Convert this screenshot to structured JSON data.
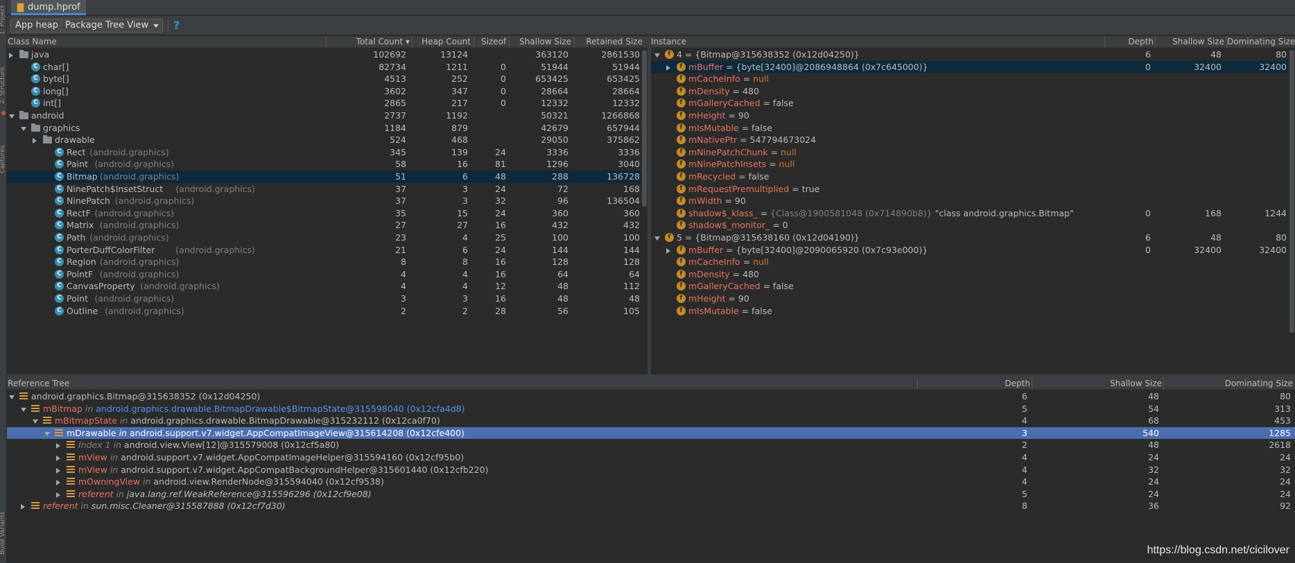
{
  "tab": {
    "title": "dump.hprof"
  },
  "toolbar": {
    "heap": "App heap",
    "view": "Package Tree View",
    "help": "?"
  },
  "sidestrip": [
    "1: Project",
    "2: Structure",
    "Captures",
    "Build Variants"
  ],
  "classTable": {
    "headers": [
      "Class Name",
      "Total Count ▾",
      "Heap Count",
      "Sizeof",
      "Shallow Size",
      "Retained Size"
    ],
    "rows": [
      {
        "indent": 0,
        "exp": "r",
        "icon": "folder",
        "name": "java",
        "pkg": "",
        "total": "102692",
        "heap": "13124",
        "sizeof": "",
        "shallow": "363120",
        "retained": "2861530"
      },
      {
        "indent": 1,
        "exp": "",
        "icon": "class",
        "name": "char[]",
        "pkg": "",
        "total": "82734",
        "heap": "1211",
        "sizeof": "0",
        "shallow": "51944",
        "retained": "51944"
      },
      {
        "indent": 1,
        "exp": "",
        "icon": "class",
        "name": "byte[]",
        "pkg": "",
        "total": "4513",
        "heap": "252",
        "sizeof": "0",
        "shallow": "653425",
        "retained": "653425"
      },
      {
        "indent": 1,
        "exp": "",
        "icon": "class",
        "name": "long[]",
        "pkg": "",
        "total": "3602",
        "heap": "347",
        "sizeof": "0",
        "shallow": "28664",
        "retained": "28664"
      },
      {
        "indent": 1,
        "exp": "",
        "icon": "class",
        "name": "int[]",
        "pkg": "",
        "total": "2865",
        "heap": "217",
        "sizeof": "0",
        "shallow": "12332",
        "retained": "12332"
      },
      {
        "indent": 0,
        "exp": "d",
        "icon": "folder",
        "name": "android",
        "pkg": "",
        "total": "2737",
        "heap": "1192",
        "sizeof": "",
        "shallow": "50321",
        "retained": "1266868"
      },
      {
        "indent": 1,
        "exp": "d",
        "icon": "folder",
        "name": "graphics",
        "pkg": "",
        "total": "1184",
        "heap": "879",
        "sizeof": "",
        "shallow": "42679",
        "retained": "657944"
      },
      {
        "indent": 2,
        "exp": "r",
        "icon": "folder",
        "name": "drawable",
        "pkg": "",
        "total": "524",
        "heap": "468",
        "sizeof": "",
        "shallow": "29050",
        "retained": "375862"
      },
      {
        "indent": 3,
        "exp": "",
        "icon": "class",
        "name": "Rect",
        "pkg": "(android.graphics)",
        "total": "345",
        "heap": "139",
        "sizeof": "24",
        "shallow": "3336",
        "retained": "3336"
      },
      {
        "indent": 3,
        "exp": "",
        "icon": "class",
        "name": "Paint",
        "pkg": "(android.graphics)",
        "total": "58",
        "heap": "16",
        "sizeof": "81",
        "shallow": "1296",
        "retained": "3040"
      },
      {
        "indent": 3,
        "exp": "",
        "icon": "class",
        "name": "Bitmap",
        "pkg": "(android.graphics)",
        "total": "51",
        "heap": "6",
        "sizeof": "48",
        "shallow": "288",
        "retained": "136728",
        "selected": true
      },
      {
        "indent": 3,
        "exp": "",
        "icon": "class",
        "name": "NinePatch$InsetStruct",
        "pkg": "(android.graphics)",
        "total": "37",
        "heap": "3",
        "sizeof": "24",
        "shallow": "72",
        "retained": "168"
      },
      {
        "indent": 3,
        "exp": "",
        "icon": "class",
        "name": "NinePatch",
        "pkg": "(android.graphics)",
        "total": "37",
        "heap": "3",
        "sizeof": "32",
        "shallow": "96",
        "retained": "136504"
      },
      {
        "indent": 3,
        "exp": "",
        "icon": "class",
        "name": "RectF",
        "pkg": "(android.graphics)",
        "total": "35",
        "heap": "15",
        "sizeof": "24",
        "shallow": "360",
        "retained": "360"
      },
      {
        "indent": 3,
        "exp": "",
        "icon": "class",
        "name": "Matrix",
        "pkg": "(android.graphics)",
        "total": "27",
        "heap": "27",
        "sizeof": "16",
        "shallow": "432",
        "retained": "432"
      },
      {
        "indent": 3,
        "exp": "",
        "icon": "class",
        "name": "Path",
        "pkg": "(android.graphics)",
        "total": "23",
        "heap": "4",
        "sizeof": "25",
        "shallow": "100",
        "retained": "100"
      },
      {
        "indent": 3,
        "exp": "",
        "icon": "class",
        "name": "PorterDuffColorFilter",
        "pkg": "(android.graphics)",
        "total": "21",
        "heap": "6",
        "sizeof": "24",
        "shallow": "144",
        "retained": "144"
      },
      {
        "indent": 3,
        "exp": "",
        "icon": "class",
        "name": "Region",
        "pkg": "(android.graphics)",
        "total": "8",
        "heap": "8",
        "sizeof": "16",
        "shallow": "128",
        "retained": "128"
      },
      {
        "indent": 3,
        "exp": "",
        "icon": "class",
        "name": "PointF",
        "pkg": "(android.graphics)",
        "total": "4",
        "heap": "4",
        "sizeof": "16",
        "shallow": "64",
        "retained": "64"
      },
      {
        "indent": 3,
        "exp": "",
        "icon": "class",
        "name": "CanvasProperty",
        "pkg": "(android.graphics)",
        "total": "4",
        "heap": "4",
        "sizeof": "12",
        "shallow": "48",
        "retained": "112"
      },
      {
        "indent": 3,
        "exp": "",
        "icon": "class",
        "name": "Point",
        "pkg": "(android.graphics)",
        "total": "3",
        "heap": "3",
        "sizeof": "16",
        "shallow": "48",
        "retained": "48"
      },
      {
        "indent": 3,
        "exp": "",
        "icon": "class",
        "name": "Outline",
        "pkg": "(android.graphics)",
        "total": "2",
        "heap": "2",
        "sizeof": "28",
        "shallow": "56",
        "retained": "105"
      }
    ]
  },
  "instanceTable": {
    "headers": [
      "Instance",
      "Depth",
      "Shallow Size",
      "Dominating Size"
    ],
    "rows": [
      {
        "indent": 0,
        "exp": "d",
        "parts": [
          [
            "4 = {Bitmap@315638352 (0x12d04250)}",
            ""
          ]
        ],
        "depth": "6",
        "shallow": "48",
        "dom": "80"
      },
      {
        "indent": 1,
        "exp": "r",
        "parts": [
          [
            "mBuffer",
            "fname"
          ],
          [
            " = {byte[32400]@2086948864 (0x7c645000)}",
            ""
          ]
        ],
        "depth": "0",
        "shallow": "32400",
        "dom": "32400",
        "selected": true
      },
      {
        "indent": 1,
        "exp": "",
        "parts": [
          [
            "mCacheInfo",
            "fname"
          ],
          [
            " = ",
            ""
          ],
          [
            "null",
            "orange"
          ]
        ],
        "depth": "",
        "shallow": "",
        "dom": ""
      },
      {
        "indent": 1,
        "exp": "",
        "parts": [
          [
            "mDensity",
            "fname"
          ],
          [
            " = 480",
            ""
          ]
        ],
        "depth": "",
        "shallow": "",
        "dom": ""
      },
      {
        "indent": 1,
        "exp": "",
        "parts": [
          [
            "mGalleryCached",
            "fname"
          ],
          [
            " = false",
            ""
          ]
        ],
        "depth": "",
        "shallow": "",
        "dom": ""
      },
      {
        "indent": 1,
        "exp": "",
        "parts": [
          [
            "mHeight",
            "fname"
          ],
          [
            " = 90",
            ""
          ]
        ],
        "depth": "",
        "shallow": "",
        "dom": ""
      },
      {
        "indent": 1,
        "exp": "",
        "parts": [
          [
            "mIsMutable",
            "fname"
          ],
          [
            " = false",
            ""
          ]
        ],
        "depth": "",
        "shallow": "",
        "dom": ""
      },
      {
        "indent": 1,
        "exp": "",
        "parts": [
          [
            "mNativePtr",
            "fname"
          ],
          [
            " = 547794673024",
            ""
          ]
        ],
        "depth": "",
        "shallow": "",
        "dom": ""
      },
      {
        "indent": 1,
        "exp": "",
        "parts": [
          [
            "mNinePatchChunk",
            "fname"
          ],
          [
            " = ",
            ""
          ],
          [
            "null",
            "orange"
          ]
        ],
        "depth": "",
        "shallow": "",
        "dom": ""
      },
      {
        "indent": 1,
        "exp": "",
        "parts": [
          [
            "mNinePatchInsets",
            "fname"
          ],
          [
            " = ",
            ""
          ],
          [
            "null",
            "orange"
          ]
        ],
        "depth": "",
        "shallow": "",
        "dom": ""
      },
      {
        "indent": 1,
        "exp": "",
        "parts": [
          [
            "mRecycled",
            "fname"
          ],
          [
            " = false",
            ""
          ]
        ],
        "depth": "",
        "shallow": "",
        "dom": ""
      },
      {
        "indent": 1,
        "exp": "",
        "parts": [
          [
            "mRequestPremultiplied",
            "fname"
          ],
          [
            " = true",
            ""
          ]
        ],
        "depth": "",
        "shallow": "",
        "dom": ""
      },
      {
        "indent": 1,
        "exp": "",
        "parts": [
          [
            "mWidth",
            "fname"
          ],
          [
            " = 90",
            ""
          ]
        ],
        "depth": "",
        "shallow": "",
        "dom": ""
      },
      {
        "indent": 1,
        "exp": "",
        "parts": [
          [
            "shadow$_klass_",
            "fname"
          ],
          [
            " = ",
            ""
          ],
          [
            "{Class@1900581048 (0x714890b8)}",
            "gray"
          ],
          [
            " \"class android.graphics.Bitmap\"",
            ""
          ]
        ],
        "depth": "0",
        "shallow": "168",
        "dom": "1244"
      },
      {
        "indent": 1,
        "exp": "",
        "parts": [
          [
            "shadow$_monitor_",
            "fname"
          ],
          [
            " = 0",
            ""
          ]
        ],
        "depth": "",
        "shallow": "",
        "dom": ""
      },
      {
        "indent": 0,
        "exp": "d",
        "parts": [
          [
            "5 = {Bitmap@315638160 (0x12d04190)}",
            ""
          ]
        ],
        "depth": "6",
        "shallow": "48",
        "dom": "80"
      },
      {
        "indent": 1,
        "exp": "r",
        "parts": [
          [
            "mBuffer",
            "fname"
          ],
          [
            " = {byte[32400]@2090065920 (0x7c93e000)}",
            ""
          ]
        ],
        "depth": "0",
        "shallow": "32400",
        "dom": "32400"
      },
      {
        "indent": 1,
        "exp": "",
        "parts": [
          [
            "mCacheInfo",
            "fname"
          ],
          [
            " = ",
            ""
          ],
          [
            "null",
            "orange"
          ]
        ],
        "depth": "",
        "shallow": "",
        "dom": ""
      },
      {
        "indent": 1,
        "exp": "",
        "parts": [
          [
            "mDensity",
            "fname"
          ],
          [
            " = 480",
            ""
          ]
        ],
        "depth": "",
        "shallow": "",
        "dom": ""
      },
      {
        "indent": 1,
        "exp": "",
        "parts": [
          [
            "mGalleryCached",
            "fname"
          ],
          [
            " = false",
            ""
          ]
        ],
        "depth": "",
        "shallow": "",
        "dom": ""
      },
      {
        "indent": 1,
        "exp": "",
        "parts": [
          [
            "mHeight",
            "fname"
          ],
          [
            " = 90",
            ""
          ]
        ],
        "depth": "",
        "shallow": "",
        "dom": ""
      },
      {
        "indent": 1,
        "exp": "",
        "parts": [
          [
            "mIsMutable",
            "fname"
          ],
          [
            " = false",
            ""
          ]
        ],
        "depth": "",
        "shallow": "",
        "dom": ""
      }
    ]
  },
  "refTree": {
    "headers": [
      "Reference Tree",
      "Depth",
      "Shallow Size",
      "Dominating Size"
    ],
    "rows": [
      {
        "indent": 0,
        "exp": "d",
        "parts": [
          [
            "android.graphics.Bitmap@315638352 (0x12d04250)",
            ""
          ]
        ],
        "depth": "6",
        "shallow": "48",
        "dom": "80"
      },
      {
        "indent": 1,
        "exp": "d",
        "parts": [
          [
            "mBitmap",
            "fname"
          ],
          [
            " in ",
            "ital gray"
          ],
          [
            "android.graphics.drawable.BitmapDrawable$BitmapState@315598040 (0x12cfa4d8)",
            "blue"
          ]
        ],
        "depth": "5",
        "shallow": "54",
        "dom": "313"
      },
      {
        "indent": 2,
        "exp": "d",
        "parts": [
          [
            "mBitmapState",
            "fname"
          ],
          [
            " in ",
            "ital gray"
          ],
          [
            "android.graphics.drawable.BitmapDrawable@315232112 (0x12ca0f70)",
            ""
          ]
        ],
        "depth": "4",
        "shallow": "68",
        "dom": "453"
      },
      {
        "indent": 3,
        "exp": "d",
        "parts": [
          [
            "mDrawable",
            ""
          ],
          [
            " in ",
            "ital"
          ],
          [
            "android.support.v7.widget.AppCompatImageView@315614208 (0x12cfe400)",
            ""
          ]
        ],
        "depth": "3",
        "shallow": "540",
        "dom": "1285",
        "selected": true
      },
      {
        "indent": 4,
        "exp": "r",
        "parts": [
          [
            "Index 1",
            "ital gray"
          ],
          [
            " in ",
            "ital gray"
          ],
          [
            "android.view.View[12]@315579008 (0x12cf5a80)",
            ""
          ]
        ],
        "depth": "2",
        "shallow": "48",
        "dom": "2618"
      },
      {
        "indent": 4,
        "exp": "r",
        "parts": [
          [
            "mView",
            "fname"
          ],
          [
            " in ",
            "ital gray"
          ],
          [
            "android.support.v7.widget.AppCompatImageHelper@315594160 (0x12cf95b0)",
            ""
          ]
        ],
        "depth": "4",
        "shallow": "24",
        "dom": "24"
      },
      {
        "indent": 4,
        "exp": "r",
        "parts": [
          [
            "mView",
            "fname"
          ],
          [
            " in ",
            "ital gray"
          ],
          [
            "android.support.v7.widget.AppCompatBackgroundHelper@315601440 (0x12cfb220)",
            ""
          ]
        ],
        "depth": "4",
        "shallow": "32",
        "dom": "32"
      },
      {
        "indent": 4,
        "exp": "r",
        "parts": [
          [
            "mOwningView",
            "fname"
          ],
          [
            " in ",
            "ital gray"
          ],
          [
            "android.view.RenderNode@315594040 (0x12cf9538)",
            ""
          ]
        ],
        "depth": "4",
        "shallow": "24",
        "dom": "24"
      },
      {
        "indent": 4,
        "exp": "r",
        "parts": [
          [
            "referent",
            "fname ital"
          ],
          [
            " in ",
            "ital gray"
          ],
          [
            "java.lang.ref.WeakReference@315596296 (0x12cf9e08)",
            "ital"
          ]
        ],
        "depth": "5",
        "shallow": "24",
        "dom": "24"
      },
      {
        "indent": 1,
        "exp": "r",
        "parts": [
          [
            "referent",
            "fname ital"
          ],
          [
            " in ",
            "ital gray"
          ],
          [
            "sun.misc.Cleaner@315587888 (0x12cf7d30)",
            "ital"
          ]
        ],
        "depth": "8",
        "shallow": "36",
        "dom": "92"
      }
    ]
  },
  "watermark": "https://blog.csdn.net/cicilover"
}
